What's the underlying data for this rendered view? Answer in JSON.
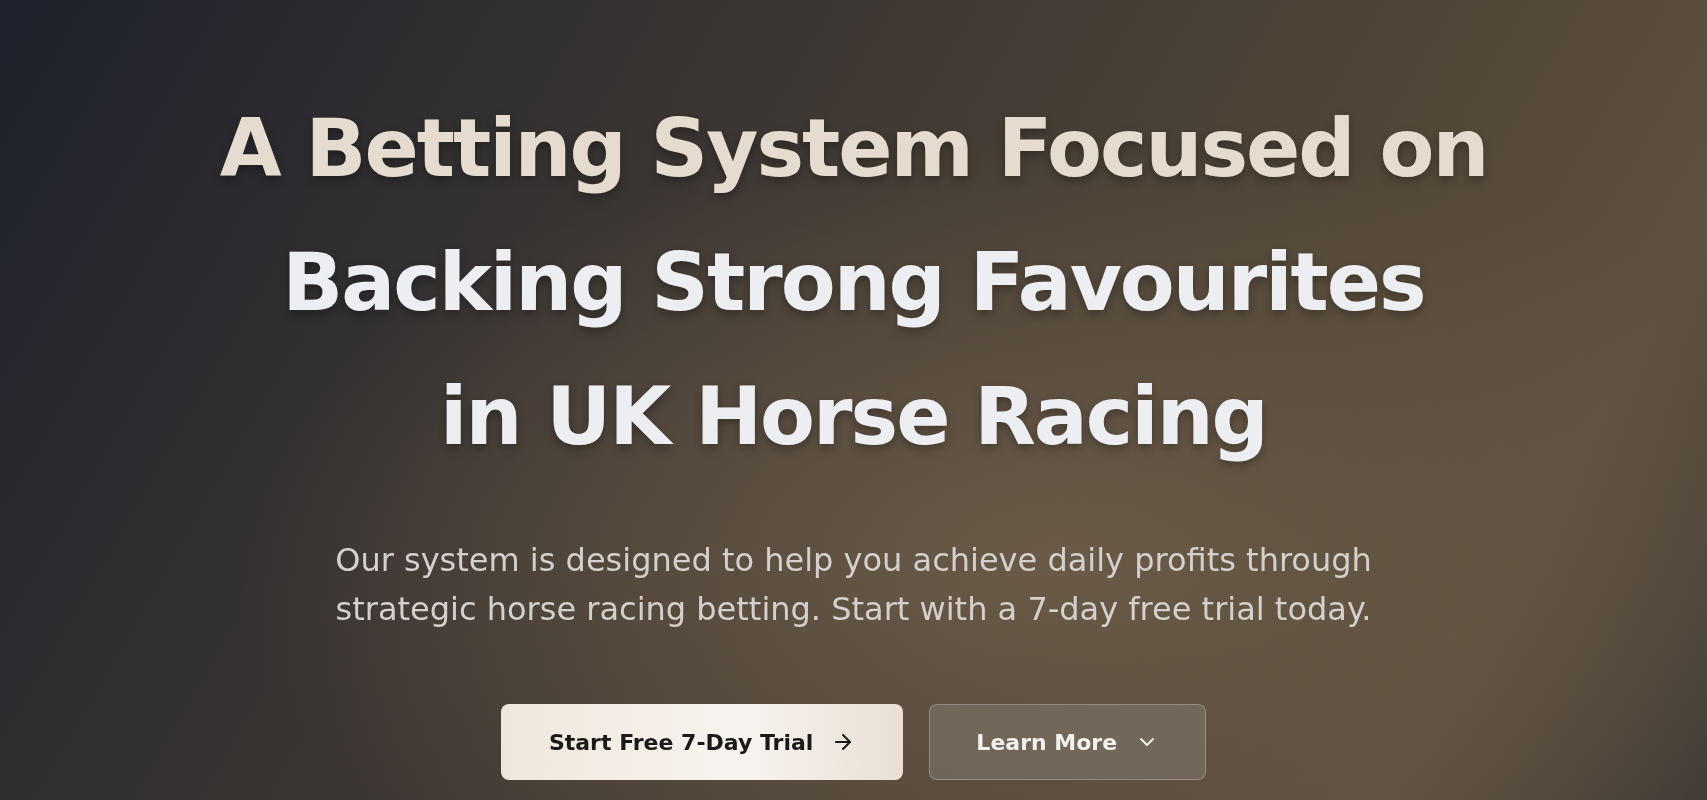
{
  "hero": {
    "heading_lines": [
      {
        "text": "A Betting System Focused on",
        "accent": true
      },
      {
        "text": "Backing Strong Favourites",
        "accent": false
      },
      {
        "text": "in UK Horse Racing",
        "accent": false
      }
    ],
    "subtitle": "Our system is designed to help you achieve daily profits through strategic horse racing betting. Start with a 7-day free trial today.",
    "buttons": [
      {
        "label": "Start Free 7-Day Trial",
        "kind": "primary"
      },
      {
        "label": "Learn More",
        "kind": "secondary"
      }
    ]
  }
}
